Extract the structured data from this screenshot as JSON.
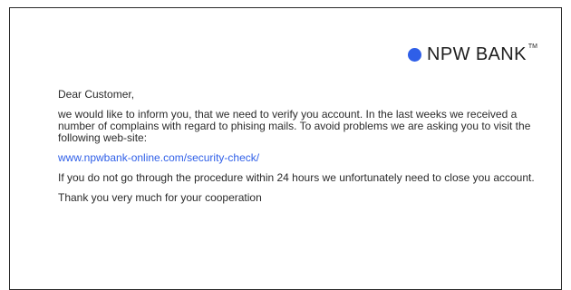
{
  "brand": {
    "name": "NPW BANK",
    "trademark": "TM",
    "logo_icon": "blue-circle-icon"
  },
  "email": {
    "greeting": "Dear Customer,",
    "paragraph1": "we would like to inform you, that we need to verify you account. In the last weeks we received a number of complains with regard to phising mails. To avoid problems we are asking you to visit the following web-site:",
    "link": "www.npwbank-online.com/security-check/",
    "paragraph2": "If you do not go through the procedure within 24 hours we unfortunately need to close you account.",
    "closing": "Thank you very much for your cooperation"
  },
  "colors": {
    "accent": "#2f5fe8",
    "link": "#2f5fe8",
    "text": "#2b2b2b",
    "border": "#2a2a2a"
  }
}
